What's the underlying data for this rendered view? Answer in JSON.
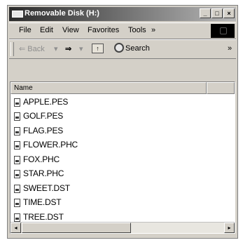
{
  "window": {
    "title": "Removable Disk (H:)",
    "buttons": [
      "_",
      "□",
      "×"
    ]
  },
  "menu": {
    "items": [
      "File",
      "Edit",
      "View",
      "Favorites",
      "Tools"
    ],
    "overflow": "»"
  },
  "toolbar": {
    "back_label": "⇐ Back",
    "back_dropdown": "▾",
    "forward_label": "⇒",
    "forward_dropdown": "▾",
    "search_label": "Search",
    "overflow": "»"
  },
  "list": {
    "column_headers": [
      "Name",
      ""
    ],
    "files": [
      "APPLE.PES",
      "GOLF.PES",
      "FLAG.PES",
      "FLOWER.PHC",
      "FOX.PHC",
      "STAR.PHC",
      "SWEET.DST",
      "TIME.DST",
      "TREE.DST"
    ]
  },
  "scrollbar": {
    "left_arrow": "◂",
    "right_arrow": "▸"
  }
}
